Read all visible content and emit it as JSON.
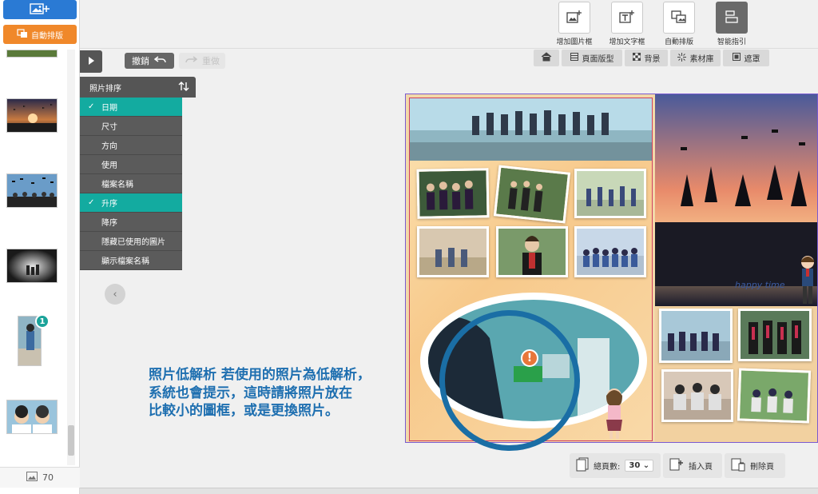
{
  "left_panel": {
    "add_photo_icon": "image-plus-icon",
    "auto_layout_label": "自動排版",
    "photo_count": "70",
    "thumbnail_badge": "1"
  },
  "editor": {
    "undo_label": "撤銷",
    "redo_label": "重做"
  },
  "sort_menu": {
    "title": "照片排序",
    "items": [
      {
        "label": "日期",
        "checked": true
      },
      {
        "label": "尺寸",
        "checked": false
      },
      {
        "label": "方向",
        "checked": false
      },
      {
        "label": "使用",
        "checked": false
      },
      {
        "label": "檔案名稱",
        "checked": false
      },
      {
        "label": "升序",
        "checked": true
      },
      {
        "label": "降序",
        "checked": false
      },
      {
        "label": "隱藏已使用的圖片",
        "checked": false
      },
      {
        "label": "顯示檔案名稱",
        "checked": false
      }
    ]
  },
  "toolbar": {
    "add_photo_frame": "增加圖片框",
    "add_text_frame": "增加文字框",
    "auto_layout": "自動排版",
    "smart_guide": "智能指引"
  },
  "tabs": {
    "page_layout": "頁面版型",
    "background": "背景",
    "materials": "素材庫",
    "mask": "遮罩"
  },
  "page_controls": {
    "total_pages_label": "總頁數:",
    "total_pages_value": "30",
    "insert_page": "插入頁",
    "delete_page": "刪除頁"
  },
  "tutorial": {
    "line1": "照片低解析 若使用的照片為低解析，",
    "line2": "系統也會提示，這時請將照片放在",
    "line3": "比較小的圖框，或是更換照片。"
  },
  "spread": {
    "caption": "happy time"
  },
  "colors": {
    "primary_blue": "#2a7ad4",
    "orange": "#f0882a",
    "teal": "#13aba0",
    "tutorial_blue": "#1e6fb0",
    "warning_orange": "#e8763a"
  }
}
